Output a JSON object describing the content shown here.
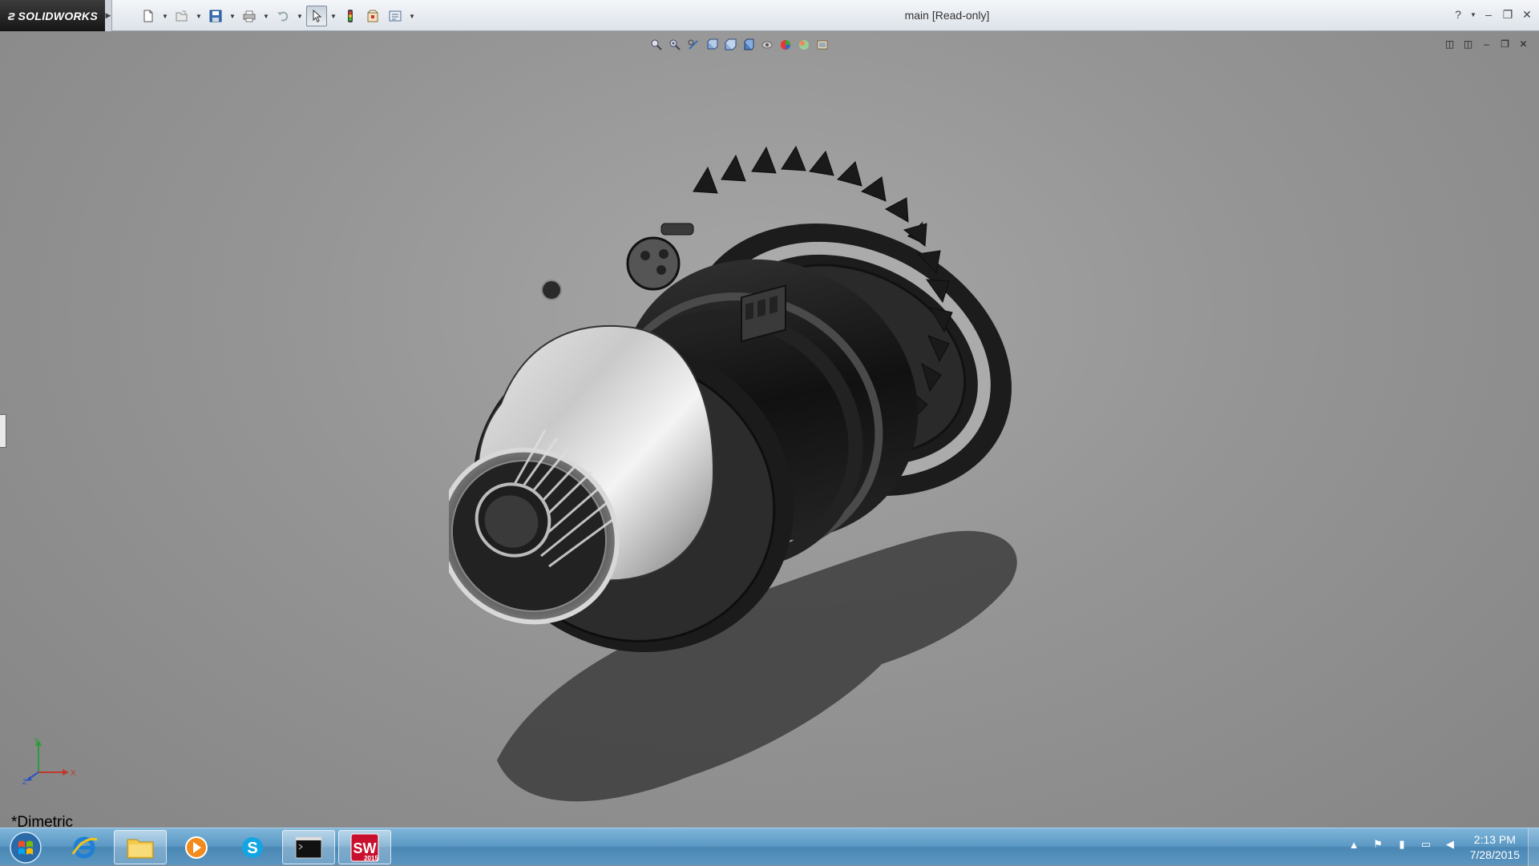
{
  "app": {
    "brand": "SOLIDWORKS",
    "document_title": "main [Read-only]"
  },
  "toolbar": {
    "icons": [
      "new-document-icon",
      "open-icon",
      "save-icon",
      "print-icon",
      "undo-icon",
      "select-icon",
      "rebuild-icon",
      "file-properties-icon",
      "options-icon"
    ]
  },
  "viewport": {
    "view_name": "*Dimetric",
    "axes": {
      "x": "X",
      "y": "Y",
      "z": "Z"
    },
    "hud_icons": [
      "zoom-to-fit-icon",
      "zoom-to-area-icon",
      "previous-view-icon",
      "section-view-icon",
      "view-orientation-icon",
      "display-style-icon",
      "hide-show-items-icon",
      "edit-appearance-icon",
      "apply-scene-icon",
      "view-settings-icon"
    ]
  },
  "taskbar": {
    "apps": [
      "internet-explorer",
      "file-explorer",
      "media-player",
      "skype",
      "command-prompt",
      "solidworks-2015"
    ],
    "solidworks_badge": "2015",
    "time": "2:13 PM",
    "date": "7/28/2015"
  },
  "colors": {
    "viewport_bg": "#959595",
    "brand_red": "#c8102e",
    "taskbar_blue": "#5b98c4"
  }
}
